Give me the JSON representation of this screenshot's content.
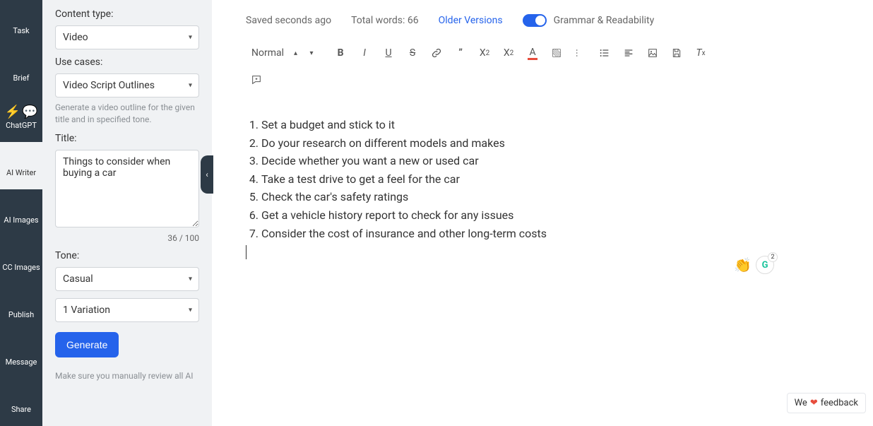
{
  "rail": {
    "items": [
      {
        "label": "Task",
        "icon": "🏠",
        "name": "nav-task"
      },
      {
        "label": "Brief",
        "icon": "🎯",
        "name": "nav-brief"
      },
      {
        "label": "ChatGPT",
        "icon": "⚡💬",
        "name": "nav-chatgpt"
      },
      {
        "label": "AI Writer",
        "icon": "✨",
        "name": "nav-ai-writer",
        "light": true
      },
      {
        "label": "AI Images",
        "icon": "🖼",
        "name": "nav-ai-images"
      },
      {
        "label": "CC Images",
        "icon": "ⓒ",
        "name": "nav-cc-images"
      },
      {
        "label": "Publish",
        "icon": "✈",
        "name": "nav-publish"
      },
      {
        "label": "Message",
        "icon": "💬",
        "name": "nav-message"
      },
      {
        "label": "Share",
        "icon": "↥",
        "name": "nav-share"
      }
    ]
  },
  "form": {
    "content_type_label": "Content type:",
    "content_type_value": "Video",
    "use_cases_label": "Use cases:",
    "use_cases_value": "Video Script Outlines",
    "use_cases_hint": "Generate a video outline for the given title and in specified tone.",
    "title_label": "Title:",
    "title_value": "Things to consider when buying a car",
    "title_counter": "36 / 100",
    "tone_label": "Tone:",
    "tone_value": "Casual",
    "variations_value": "1 Variation",
    "generate_label": "Generate",
    "review_note": "Make sure you manually review all AI"
  },
  "topbar": {
    "saved": "Saved seconds ago",
    "words": "Total words: 66",
    "older": "Older Versions",
    "grammar": "Grammar & Readability"
  },
  "toolbar": {
    "format": "Normal"
  },
  "content_items": [
    "Set a budget and stick to it",
    "Do your research on different models and makes",
    "Decide whether you want a new or used car",
    "Take a test drive to get a feel for the car",
    "Check the car's safety ratings",
    "Get a vehicle history report to check for any issues",
    "Consider the cost of insurance and other long-term costs"
  ],
  "widgets": {
    "clap": "👏",
    "g": "G",
    "g_badge": "2"
  },
  "feedback": {
    "pre": "We",
    "heart": "❤",
    "post": "feedback"
  }
}
